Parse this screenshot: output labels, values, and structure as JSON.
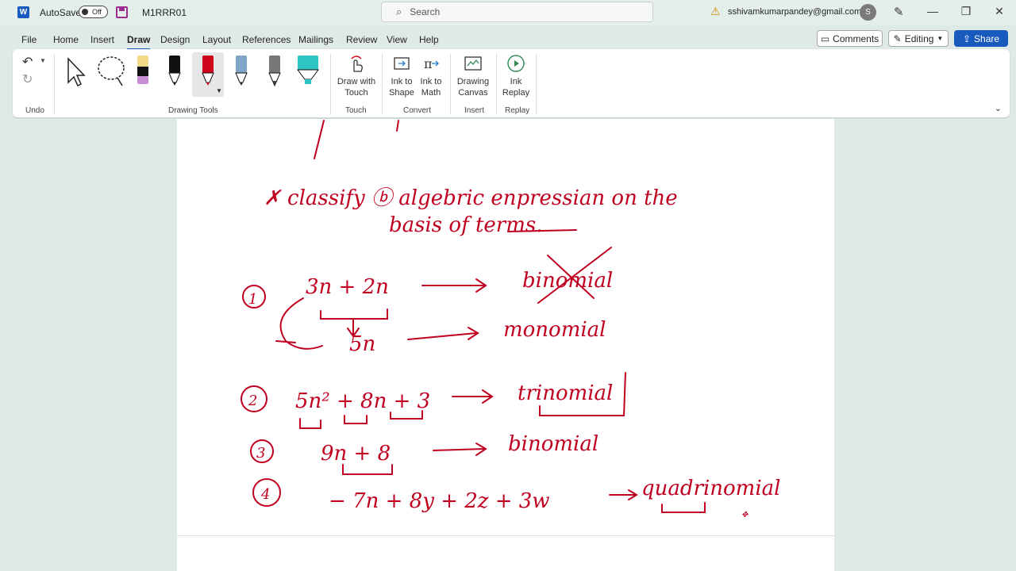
{
  "titlebar": {
    "app_logo": "W",
    "autosave_label": "AutoSave",
    "autosave_state": "Off",
    "doc_name": "M1RRR01",
    "search_placeholder": "Search",
    "account_email": "sshivamkumarpandey@gmail.com",
    "avatar_initial": "S"
  },
  "menu": {
    "tabs": [
      "File",
      "Home",
      "Insert",
      "Draw",
      "Design",
      "Layout",
      "References",
      "Mailings",
      "Review",
      "View",
      "Help"
    ],
    "active_tab": "Draw",
    "comments_label": "Comments",
    "editing_label": "Editing",
    "share_label": "Share"
  },
  "ribbon": {
    "groups": {
      "undo": "Undo",
      "drawing_tools": "Drawing Tools",
      "touch": "Touch",
      "convert": "Convert",
      "insert": "Insert",
      "replay": "Replay"
    },
    "buttons": {
      "draw_with_touch": [
        "Draw with",
        "Touch"
      ],
      "ink_to_shape": [
        "Ink to",
        "Shape"
      ],
      "ink_to_math": [
        "Ink to",
        "Math"
      ],
      "drawing_canvas": [
        "Drawing",
        "Canvas"
      ],
      "ink_replay": [
        "Ink",
        "Replay"
      ]
    },
    "pen_colors": [
      "#111111",
      "#111111",
      "#d0021b",
      "#1a1a1a",
      "#444444",
      "#1a1a1a"
    ],
    "highlighter_colors": [
      "#f2d98a",
      "#2ec4c4"
    ]
  },
  "document": {
    "ink_color": "#c00020",
    "lines": {
      "heading1": "✗ classify ⓑ algebric  enpressian  on  the",
      "heading2": "basis  of  terms.",
      "item1_num": "1",
      "item1_expr": "3n + 2n",
      "item1_label": "binomial",
      "item1_sub_expr": "5n",
      "item1_sub_label": "monomial",
      "item2_num": "2",
      "item2_expr": "5n² + 8n + 3",
      "item2_label": "trinomial",
      "item3_num": "3",
      "item3_expr": "9n + 8",
      "item3_label": "binomial",
      "item4_num": "4",
      "item4_expr": "− 7n + 8y + 2z + 3w",
      "item4_label": "quadrinomial"
    }
  }
}
